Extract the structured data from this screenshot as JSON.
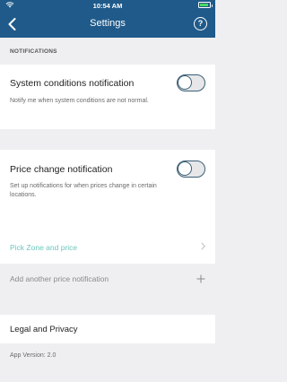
{
  "status_bar": {
    "time": "10:54 AM"
  },
  "nav": {
    "title": "Settings",
    "help_symbol": "?"
  },
  "notifications_section": {
    "header": "NOTIFICATIONS"
  },
  "system_conditions": {
    "label": "System conditions notification",
    "description": "Notify me when system conditions are not normal.",
    "enabled": false
  },
  "price_change": {
    "label": "Price change notification",
    "description": "Set up notifications for when prices change in certain locations.",
    "enabled": false,
    "pick_zone_label": "Pick Zone and price",
    "add_another_label": "Add another price notification"
  },
  "legal": {
    "label": "Legal and Privacy"
  },
  "app_version": "App Version: 2.0",
  "colors": {
    "nav_bg": "#1f5a8a",
    "accent": "#6cc7be",
    "toggle_border": "#3a5f74"
  },
  "icons": {
    "back": "back-chevron-icon",
    "help": "help-icon",
    "chevron": "chevron-right-icon",
    "plus": "plus-icon",
    "wifi": "wifi-icon",
    "battery": "battery-icon"
  }
}
